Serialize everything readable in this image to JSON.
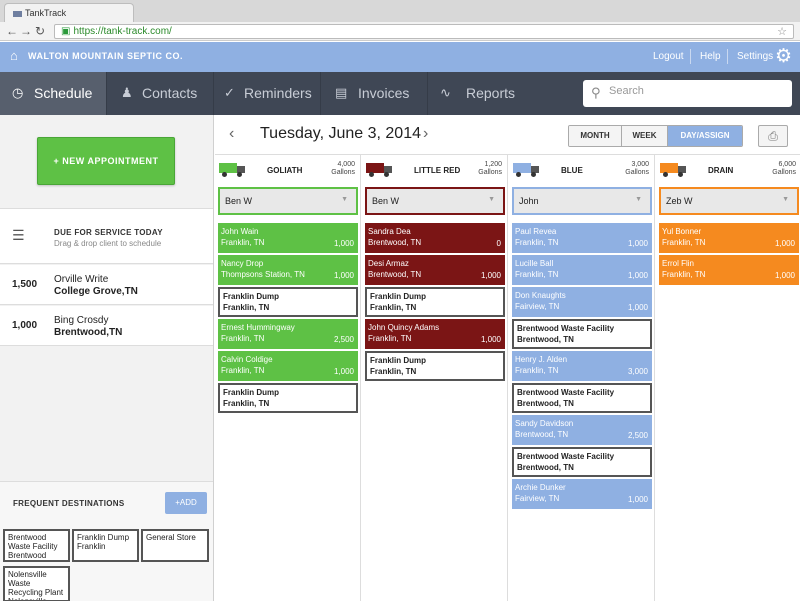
{
  "browser": {
    "tab_title": "TankTrack",
    "url": "https://tank-track.com/"
  },
  "topbar": {
    "company": "WALTON MOUNTAIN SEPTIC CO.",
    "logout": "Logout",
    "help": "Help",
    "settings": "Settings"
  },
  "nav": {
    "tabs": [
      {
        "label": "Schedule",
        "icon": "clock-icon"
      },
      {
        "label": "Contacts",
        "icon": "person-icon"
      },
      {
        "label": "Reminders",
        "icon": "check-icon"
      },
      {
        "label": "Invoices",
        "icon": "invoice-icon"
      },
      {
        "label": "Reports",
        "icon": "chart-icon"
      }
    ],
    "search_placeholder": "Search"
  },
  "sidebar": {
    "new_appointment": "+ NEW APPOINTMENT",
    "due_title": "DUE FOR SERVICE TODAY",
    "due_subtitle": "Drag & drop client to schedule",
    "clients": [
      {
        "amount": "1,500",
        "name": "Orville Write",
        "location": "College Grove,TN"
      },
      {
        "amount": "1,000",
        "name": "Bing Crosdy",
        "location": "Brentwood,TN"
      }
    ],
    "frequent_title": "FREQUENT DESTINATIONS",
    "add_label": "+ADD",
    "destinations": [
      "Brentwood Waste Facility Brentwood",
      "Franklin Dump Franklin",
      "General Store",
      "Nolensville Waste Recycling Plant Nolensville"
    ]
  },
  "schedule": {
    "date": "Tuesday, June 3, 2014",
    "views": [
      "MONTH",
      "WEEK",
      "DAY/ASSIGN"
    ],
    "trucks": [
      {
        "name": "GOLIATH",
        "capacity": "4,000",
        "unit": "Gallons",
        "driver": "Ben W",
        "color": "#5ec145",
        "appointments": [
          {
            "name": "John Wain",
            "location": "Franklin, TN",
            "gallons": "1,000",
            "type": "client"
          },
          {
            "name": "Nancy Drop",
            "location": "Thompsons Station, TN",
            "gallons": "1,000",
            "type": "client"
          },
          {
            "name": "Franklin Dump",
            "location": "Franklin, TN",
            "gallons": "",
            "type": "destination"
          },
          {
            "name": "Ernest Hummingway",
            "location": "Franklin, TN",
            "gallons": "2,500",
            "type": "client"
          },
          {
            "name": "Calvin Coldige",
            "location": "Franklin, TN",
            "gallons": "1,000",
            "type": "client"
          },
          {
            "name": "Franklin Dump",
            "location": "Franklin, TN",
            "gallons": "",
            "type": "destination"
          }
        ]
      },
      {
        "name": "LITTLE RED",
        "capacity": "1,200",
        "unit": "Gallons",
        "driver": "Ben W",
        "color": "#7b1515",
        "appointments": [
          {
            "name": "Sandra Dea",
            "location": "Brentwood, TN",
            "gallons": "0",
            "type": "client"
          },
          {
            "name": "Desi Armaz",
            "location": "Brentwood, TN",
            "gallons": "1,000",
            "type": "client"
          },
          {
            "name": "Franklin Dump",
            "location": "Franklin, TN",
            "gallons": "",
            "type": "destination"
          },
          {
            "name": "John Quincy Adams",
            "location": "Franklin, TN",
            "gallons": "1,000",
            "type": "client"
          },
          {
            "name": "Franklin Dump",
            "location": "Franklin, TN",
            "gallons": "",
            "type": "destination"
          }
        ]
      },
      {
        "name": "BLUE",
        "capacity": "3,000",
        "unit": "Gallons",
        "driver": "John",
        "color": "#8fb0e2",
        "appointments": [
          {
            "name": "Paul Revea",
            "location": "Franklin, TN",
            "gallons": "1,000",
            "type": "client"
          },
          {
            "name": "Lucille Ball",
            "location": "Franklin, TN",
            "gallons": "1,000",
            "type": "client"
          },
          {
            "name": "Don Knaughts",
            "location": "Fairview, TN",
            "gallons": "1,000",
            "type": "client"
          },
          {
            "name": "Brentwood Waste Facility",
            "location": "Brentwood, TN",
            "gallons": "",
            "type": "destination"
          },
          {
            "name": "Henry J. Alden",
            "location": "Franklin, TN",
            "gallons": "3,000",
            "type": "client"
          },
          {
            "name": "Brentwood Waste Facility",
            "location": "Brentwood, TN",
            "gallons": "",
            "type": "destination"
          },
          {
            "name": "Sandy Davidson",
            "location": "Brentwood, TN",
            "gallons": "2,500",
            "type": "client"
          },
          {
            "name": "Brentwood Waste Facility",
            "location": "Brentwood, TN",
            "gallons": "",
            "type": "destination"
          },
          {
            "name": "Archie Dunker",
            "location": "Fairview, TN",
            "gallons": "1,000",
            "type": "client"
          }
        ]
      },
      {
        "name": "DRAIN",
        "capacity": "6,000",
        "unit": "Gallons",
        "driver": "Zeb W",
        "color": "#f58a1f",
        "appointments": [
          {
            "name": "Yul Bonner",
            "location": "Franklin, TN",
            "gallons": "1,000",
            "type": "client"
          },
          {
            "name": "Errol Flin",
            "location": "Franklin, TN",
            "gallons": "1,000",
            "type": "client"
          }
        ]
      }
    ]
  }
}
